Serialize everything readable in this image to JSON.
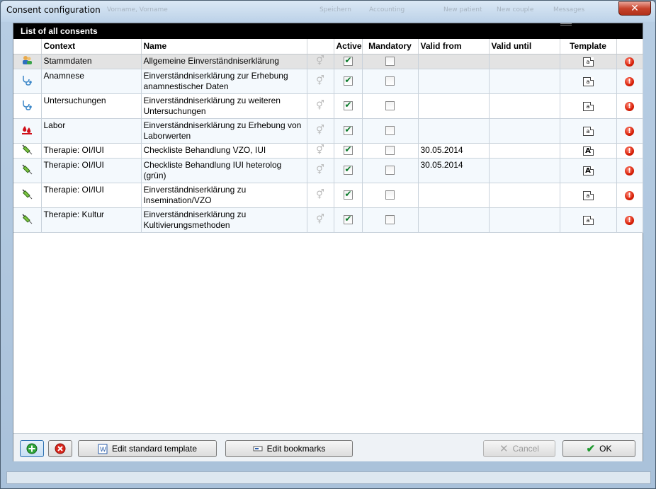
{
  "window": {
    "title": "Consent configuration",
    "close_glyph": "✕"
  },
  "ghost_menu": [
    "Vorname, Vorname",
    "Speichern",
    "Accounting",
    "New patient",
    "New couple",
    "Messages"
  ],
  "panel": {
    "header": "List of all consents"
  },
  "columns": {
    "context": "Context",
    "name": "Name",
    "gender": "",
    "active": "Active",
    "mandatory": "Mandatory",
    "valid_from": "Valid from",
    "valid_until": "Valid until",
    "template": "Template",
    "status": ""
  },
  "rows": [
    {
      "icon": "people-icon",
      "context": "Stammdaten",
      "name": "Allgemeine Einverständniserklärung",
      "active": true,
      "mandatory": false,
      "valid_from": "",
      "valid_until": "",
      "template_bold": false,
      "selected": true
    },
    {
      "icon": "stethoscope-icon",
      "context": "Anamnese",
      "name": "Einverständniserklärung zur Erhebung anamnestischer Daten",
      "active": true,
      "mandatory": false,
      "valid_from": "",
      "valid_until": "",
      "template_bold": false,
      "selected": false
    },
    {
      "icon": "stethoscope-icon",
      "context": "Untersuchungen",
      "name": "Einverständniserklärung zu weiteren Untersuchungen",
      "active": true,
      "mandatory": false,
      "valid_from": "",
      "valid_until": "",
      "template_bold": false,
      "selected": false
    },
    {
      "icon": "blood-drops-icon",
      "context": "Labor",
      "name": "Einverständniserklärung zu Erhebung von Laborwerten",
      "active": true,
      "mandatory": false,
      "valid_from": "",
      "valid_until": "",
      "template_bold": false,
      "selected": false
    },
    {
      "icon": "syringe-icon",
      "context": "Therapie: OI/IUI",
      "name": "Checkliste Behandlung VZO, IUI",
      "active": true,
      "mandatory": false,
      "valid_from": "30.05.2014",
      "valid_until": "",
      "template_bold": true,
      "selected": false
    },
    {
      "icon": "syringe-icon",
      "context": "Therapie: OI/IUI",
      "name": "Checkliste Behandlung  IUI heterolog (grün)",
      "active": true,
      "mandatory": false,
      "valid_from": "30.05.2014",
      "valid_until": "",
      "template_bold": true,
      "selected": false
    },
    {
      "icon": "syringe-icon",
      "context": "Therapie: OI/IUI",
      "name": "Einverständniserklärung zu Insemination/VZO",
      "active": true,
      "mandatory": false,
      "valid_from": "",
      "valid_until": "",
      "template_bold": false,
      "selected": false
    },
    {
      "icon": "syringe-icon",
      "context": "Therapie: Kultur",
      "name": "Einverständniserklärung zu Kultivierungsmethoden",
      "active": true,
      "mandatory": false,
      "valid_from": "",
      "valid_until": "",
      "template_bold": false,
      "selected": false
    }
  ],
  "glyphs": {
    "gender": "⚥",
    "template": "a",
    "template_bold": "A",
    "warning": "!"
  },
  "buttons": {
    "edit_standard_template": "Edit standard template",
    "edit_bookmarks": "Edit bookmarks",
    "cancel": "Cancel",
    "ok": "OK"
  },
  "colors": {
    "header_bg": "#000000",
    "selected_row": "#e3e3e3",
    "alt_row": "#f4f9fd",
    "check_green": "#0a7a2a",
    "warning_red": "#d81e05"
  }
}
